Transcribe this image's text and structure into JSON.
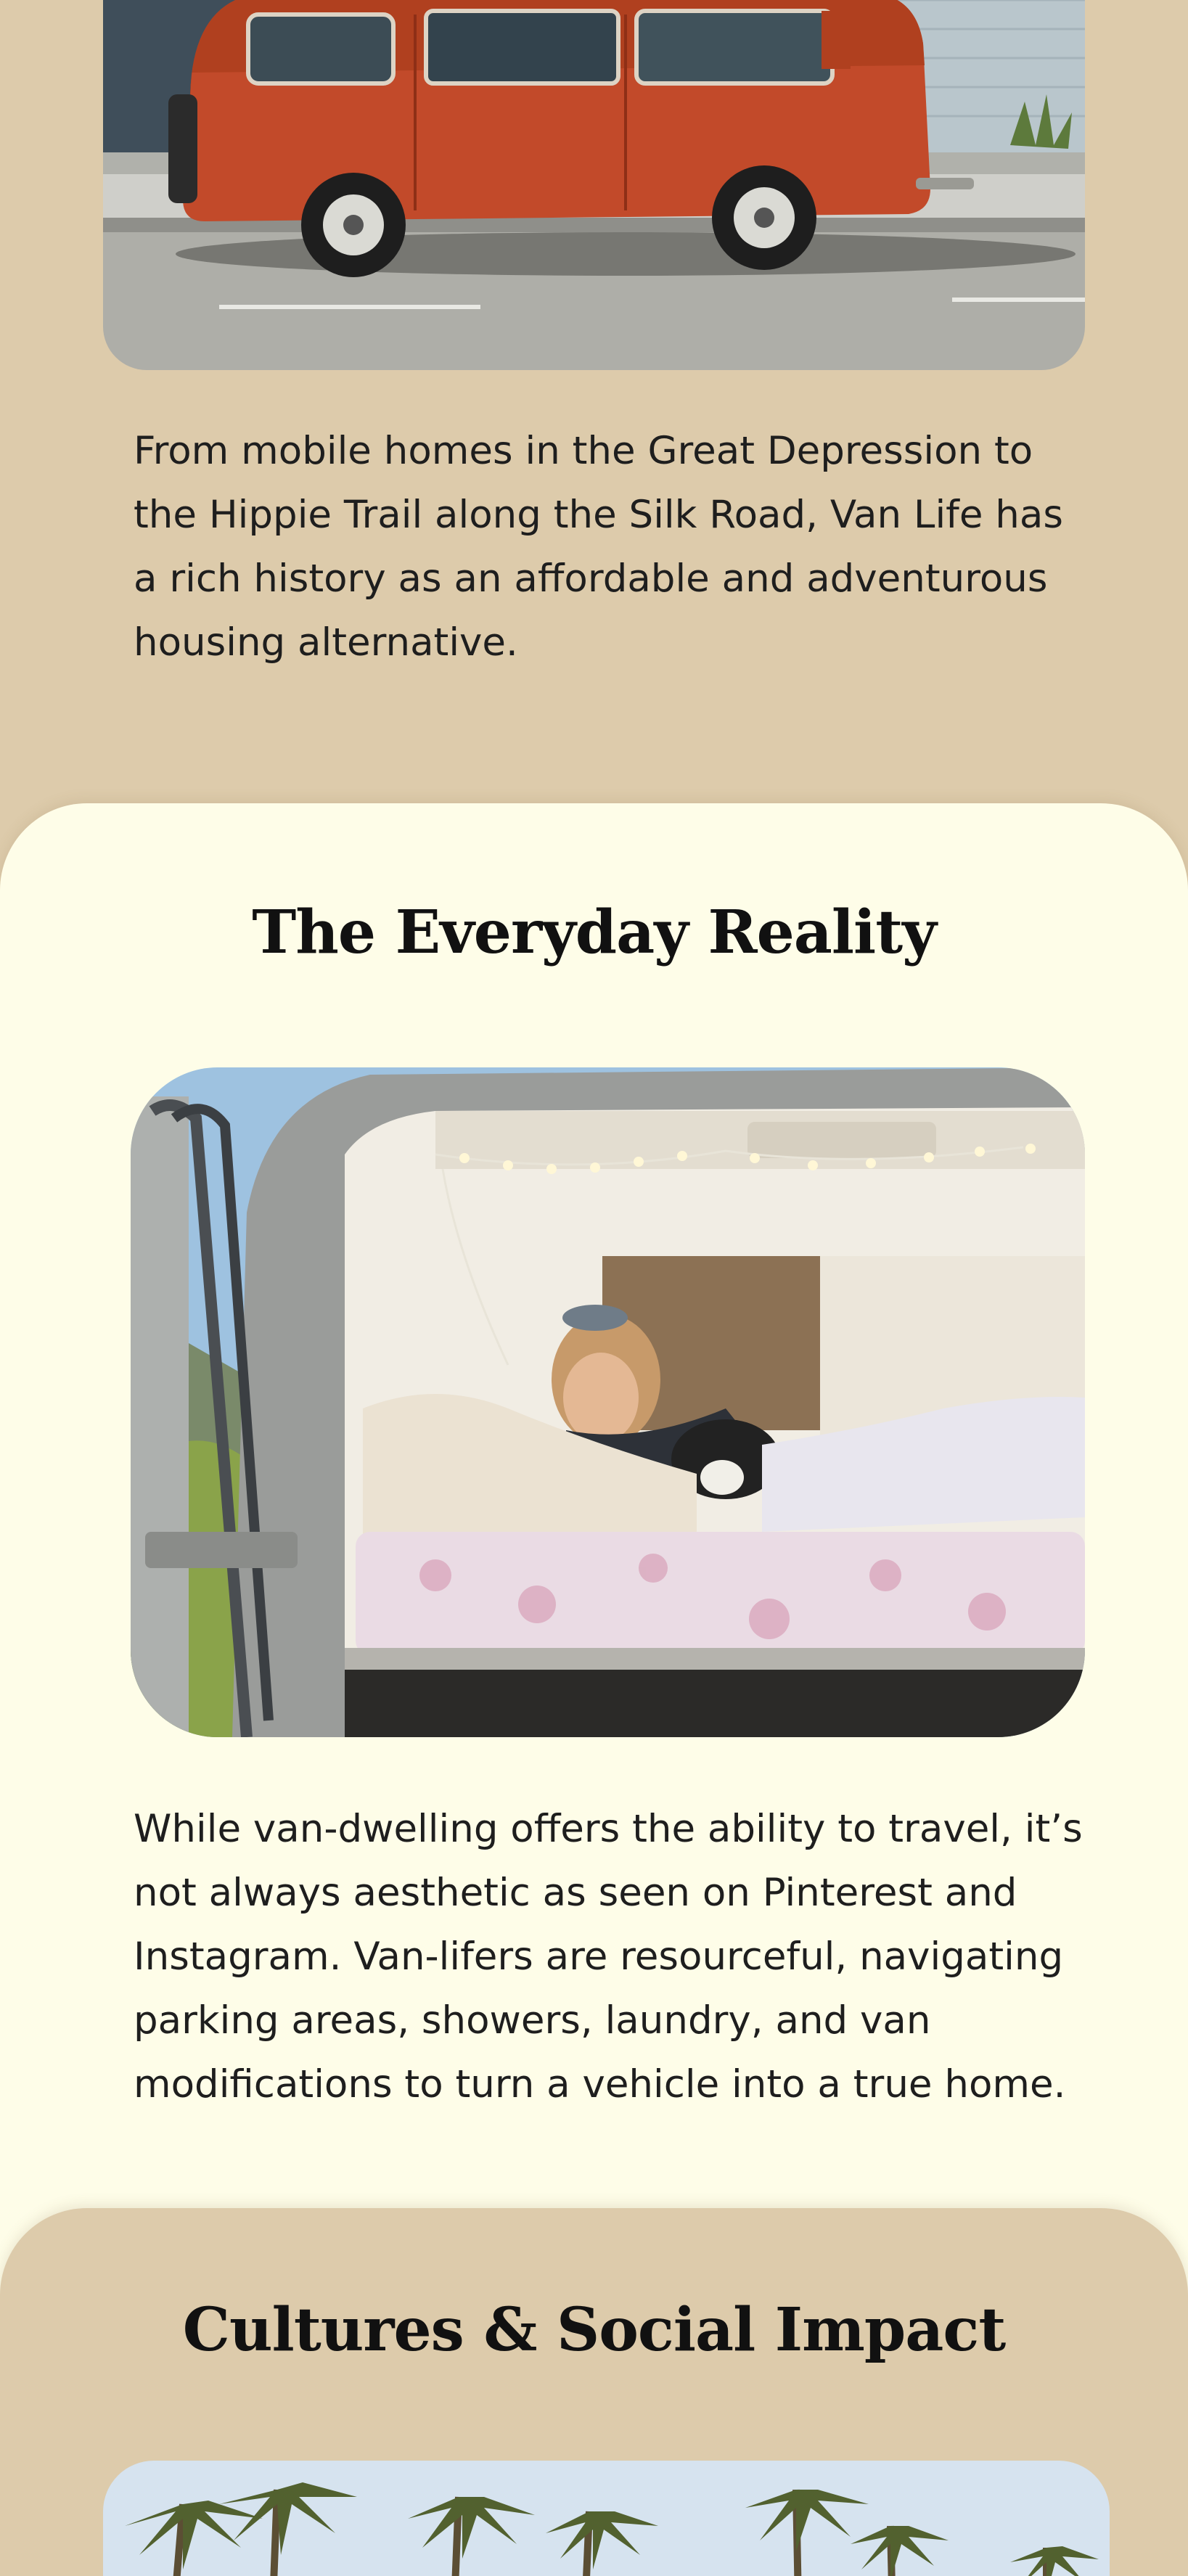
{
  "history": {
    "image_alt": "Vintage orange VW bus parked on a street",
    "paragraph": "From mobile homes in the Great Depression to the Hippie Trail along the Silk Road, Van Life has a rich history as an affordable and adventurous housing alternative."
  },
  "everyday": {
    "heading": "The Everyday Reality",
    "image_alt": "Woman lying in the back of a van with a dog",
    "paragraph": "While van-dwelling offers the ability to travel, it’s not always aesthetic as seen on Pinterest and Instagram. Van-lifers are resourceful, navigating parking areas, showers, laundry, and van modifications to turn a vehicle into a true home."
  },
  "cultures": {
    "heading": "Cultures & Social Impact",
    "image_alt": "Palm trees against a pale sky"
  },
  "colors": {
    "tan_background": "#ddcbab",
    "cream_background": "#fefde8",
    "text": "#1e1e1e"
  }
}
